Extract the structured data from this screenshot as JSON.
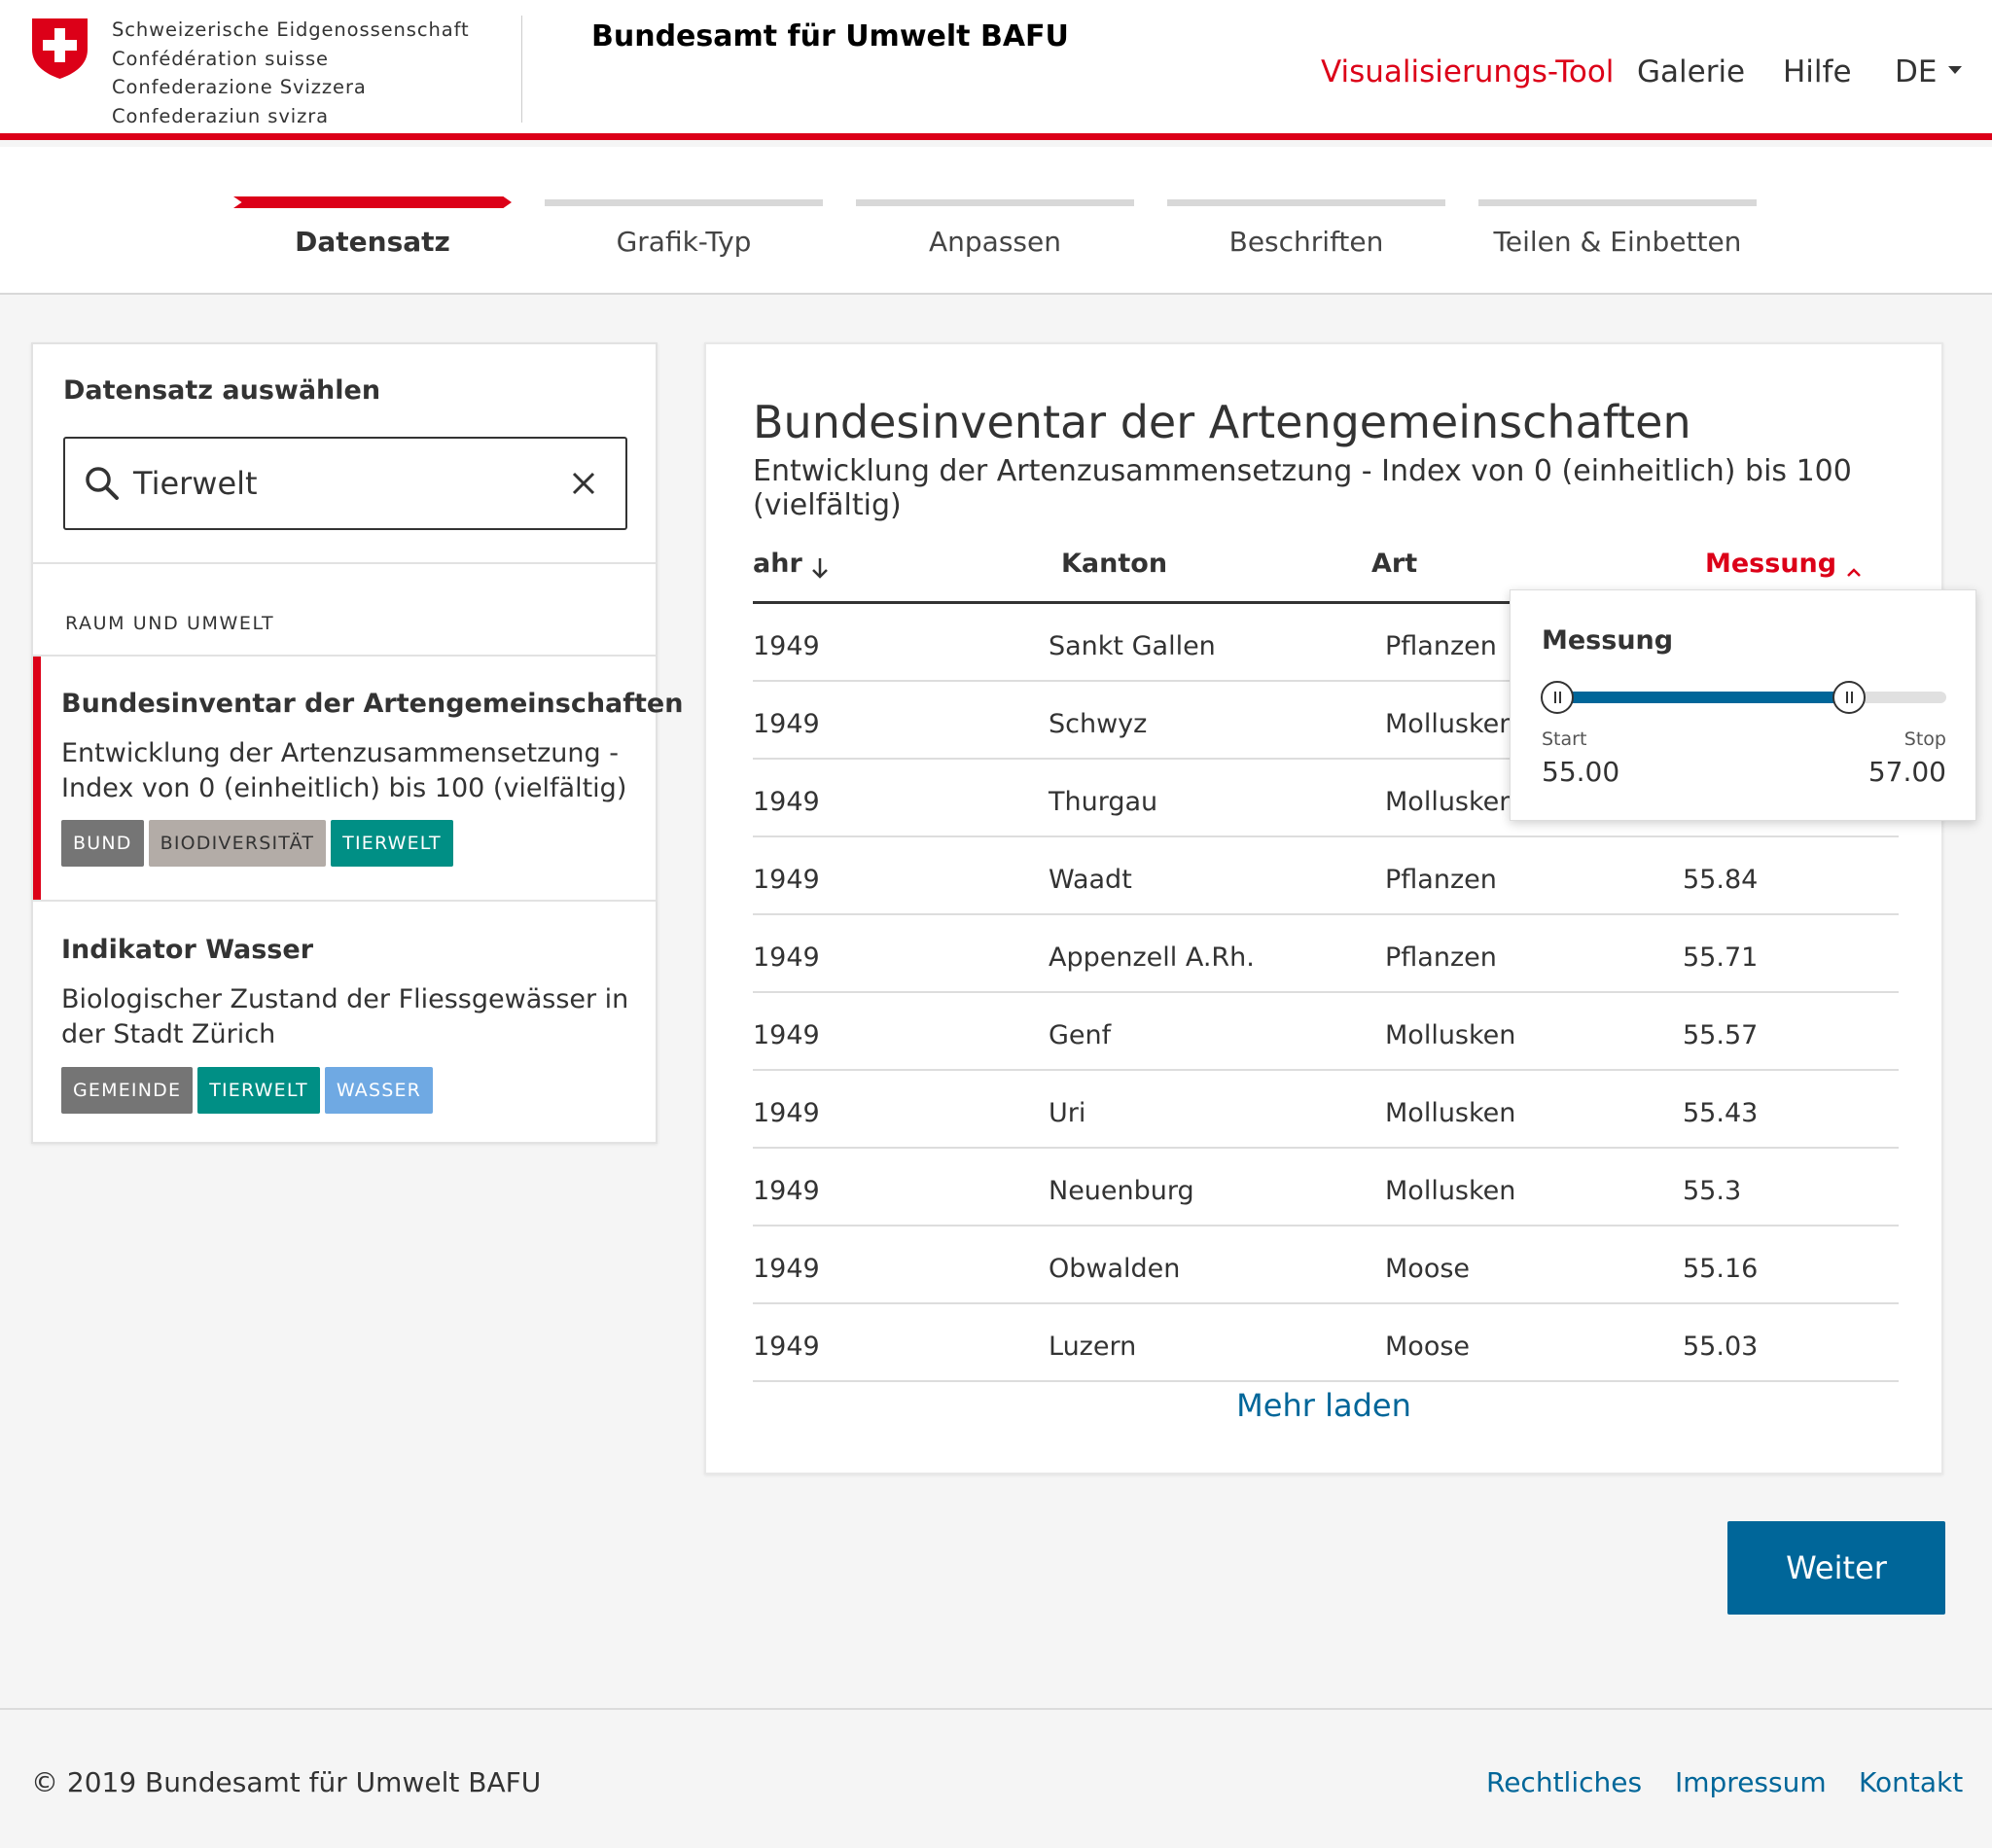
{
  "header": {
    "confederation_lines": [
      "Schweizerische Eidgenossenschaft",
      "Confédération suisse",
      "Confederazione Svizzera",
      "Confederaziun svizra"
    ],
    "office": "Bundesamt für Umwelt BAFU",
    "nav": [
      "Visualisierungs-Tool",
      "Galerie",
      "Hilfe"
    ],
    "active_nav": "Visualisierungs-Tool",
    "language": "DE"
  },
  "steps": [
    {
      "label": "Datensatz",
      "active": true
    },
    {
      "label": "Grafik-Typ",
      "active": false
    },
    {
      "label": "Anpassen",
      "active": false
    },
    {
      "label": "Beschriften",
      "active": false
    },
    {
      "label": "Teilen & Einbetten",
      "active": false
    }
  ],
  "dataset_panel": {
    "title": "Datensatz auswählen",
    "search_value": "Tierwelt",
    "section_label": "RAUM UND UMWELT",
    "datasets": [
      {
        "title": "Bundesinventar der Artengemeinschaften",
        "description": "Entwicklung der Artenzusammensetzung - Index von 0 (einheitlich) bis 100 (vielfältig)",
        "selected": true,
        "tags": [
          {
            "label": "BUND",
            "color": "#757575"
          },
          {
            "label": "BIODIVERSITÄT",
            "color": "#b3aca7",
            "text_color": "#333333"
          },
          {
            "label": "TIERWELT",
            "color": "#008f85"
          }
        ]
      },
      {
        "title": "Indikator Wasser",
        "description": "Biologischer Zustand der Fliessgewässer in der Stadt Zürich",
        "selected": false,
        "tags": [
          {
            "label": "GEMEINDE",
            "color": "#757575"
          },
          {
            "label": "TIERWELT",
            "color": "#008f85"
          },
          {
            "label": "WASSER",
            "color": "#6fa9e3"
          }
        ]
      }
    ]
  },
  "preview": {
    "title": "Bundesinventar der Artengemeinschaften",
    "subtitle": "Entwicklung der Artenzusammensetzung - Index von 0 (einheitlich) bis 100 (vielfältig)",
    "columns": [
      "Jahr",
      "Kanton",
      "Art",
      "Messung"
    ],
    "sorted_column": "Messung",
    "rows": [
      [
        "1949",
        "Sankt Gallen",
        "Pflanzen",
        ""
      ],
      [
        "1949",
        "Schwyz",
        "Mollusken",
        ""
      ],
      [
        "1949",
        "Thurgau",
        "Mollusken",
        ""
      ],
      [
        "1949",
        "Waadt",
        "Pflanzen",
        "55.84"
      ],
      [
        "1949",
        "Appenzell A.Rh.",
        "Pflanzen",
        "55.71"
      ],
      [
        "1949",
        "Genf",
        "Mollusken",
        "55.57"
      ],
      [
        "1949",
        "Uri",
        "Mollusken",
        "55.43"
      ],
      [
        "1949",
        "Neuenburg",
        "Mollusken",
        "55.3"
      ],
      [
        "1949",
        "Obwalden",
        "Moose",
        "55.16"
      ],
      [
        "1949",
        "Luzern",
        "Moose",
        "55.03"
      ]
    ],
    "load_more": "Mehr laden"
  },
  "filter_popover": {
    "title": "Messung",
    "start_label": "Start",
    "stop_label": "Stop",
    "start_value": "55.00",
    "stop_value": "57.00"
  },
  "next_button": "Weiter",
  "footer": {
    "copyright": "© 2019 Bundesamt für Umwelt BAFU",
    "links": [
      "Rechtliches",
      "Impressum",
      "Kontakt"
    ]
  },
  "colors": {
    "accent_red": "#dc0018",
    "link_blue": "#006699"
  }
}
